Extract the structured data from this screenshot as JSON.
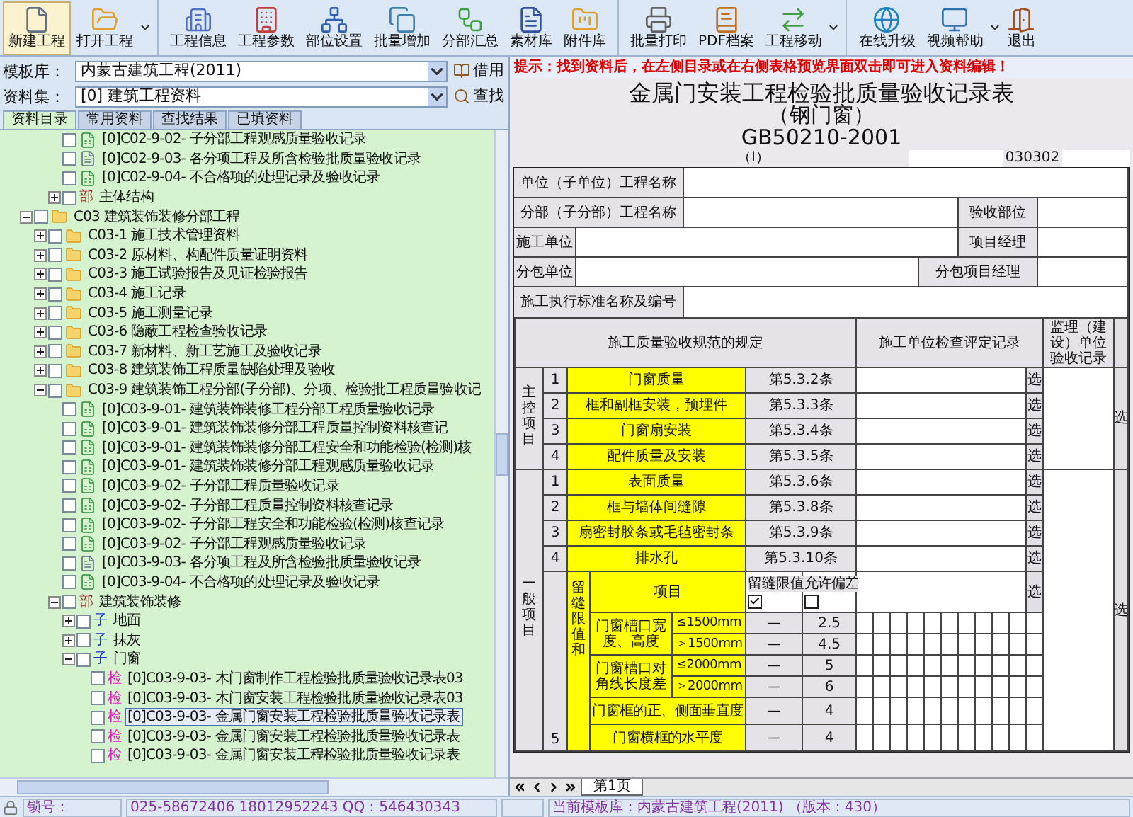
{
  "toolbar": {
    "groups": [
      {
        "items": [
          {
            "label": "新建工程",
            "selected": true,
            "dropdown": false
          },
          {
            "label": "打开工程",
            "selected": false,
            "dropdown": true
          }
        ]
      },
      {
        "items": [
          {
            "label": "工程信息",
            "selected": false,
            "dropdown": false
          },
          {
            "label": "工程参数",
            "selected": false,
            "dropdown": false
          },
          {
            "label": "部位设置",
            "selected": false,
            "dropdown": false
          },
          {
            "label": "批量增加",
            "selected": false,
            "dropdown": false
          },
          {
            "label": "分部汇总",
            "selected": false,
            "dropdown": false
          },
          {
            "label": "素材库",
            "selected": false,
            "dropdown": false
          },
          {
            "label": "附件库",
            "selected": false,
            "dropdown": false
          }
        ]
      },
      {
        "items": [
          {
            "label": "批量打印",
            "selected": false,
            "dropdown": false
          },
          {
            "label": "PDF档案",
            "selected": false,
            "dropdown": false
          },
          {
            "label": "工程移动",
            "selected": false,
            "dropdown": true
          }
        ]
      },
      {
        "items": [
          {
            "label": "在线升级",
            "selected": false,
            "dropdown": false
          },
          {
            "label": "视频帮助",
            "selected": false,
            "dropdown": true
          },
          {
            "label": "退出",
            "selected": false,
            "dropdown": false
          }
        ]
      }
    ]
  },
  "template_library": {
    "label": "模板库：",
    "value": "内蒙古建筑工程(2011)",
    "button": "借用"
  },
  "data_set": {
    "label": "资料集：",
    "value": "[0] 建筑工程资料",
    "button": "查找"
  },
  "tabs": [
    {
      "label": "资料目录",
      "selected": true
    },
    {
      "label": "常用资料",
      "selected": false
    },
    {
      "label": "查找结果",
      "selected": false
    },
    {
      "label": "已填资料",
      "selected": false
    }
  ],
  "tree": [
    {
      "children": [
        {
          "children": [
            {
              "label": "[0]C02-9-02- 子分部工程观感质量验收记录",
              "kind": "sheet",
              "checked": false,
              "selected": false
            },
            {
              "label": "[0]C02-9-03- 各分项工程及所含检验批质量验收记录",
              "kind": "document",
              "checked": false,
              "selected": false
            },
            {
              "label": "[0]C02-9-04- 不合格项的处理记录及验收记录",
              "kind": "sheet",
              "checked": false,
              "selected": false
            },
            {
              "label": "主体结构",
              "kind": "tag",
              "tag": "部",
              "color": "#a52a2a",
              "expanded": false,
              "checked": false,
              "selected": false
            }
          ]
        }
      ]
    },
    {
      "label": "C03 建筑装饰装修分部工程",
      "kind": "folder",
      "expanded": true,
      "checked": false,
      "selected": false,
      "children": [
        {
          "label": "C03-1 施工技术管理资料",
          "kind": "folder",
          "expanded": false,
          "checked": false,
          "selected": false
        },
        {
          "label": "C03-2 原材料、构配件质量证明资料",
          "kind": "folder",
          "expanded": false,
          "checked": false,
          "selected": false
        },
        {
          "label": "C03-3 施工试验报告及见证检验报告",
          "kind": "folder",
          "expanded": false,
          "checked": false,
          "selected": false
        },
        {
          "label": "C03-4 施工记录",
          "kind": "folder",
          "expanded": false,
          "checked": false,
          "selected": false
        },
        {
          "label": "C03-5 施工测量记录",
          "kind": "folder",
          "expanded": false,
          "checked": false,
          "selected": false
        },
        {
          "label": "C03-6 隐蔽工程检查验收记录",
          "kind": "folder",
          "expanded": false,
          "checked": false,
          "selected": false
        },
        {
          "label": "C03-7 新材料、新工艺施工及验收记录",
          "kind": "folder",
          "expanded": false,
          "checked": false,
          "selected": false
        },
        {
          "label": "C03-8 建筑装饰工程质量缺陷处理及验收",
          "kind": "folder",
          "expanded": false,
          "checked": false,
          "selected": false
        },
        {
          "label": "C03-9 建筑装饰工程分部(子分部)、分项、检验批工程质量验收记",
          "kind": "folder",
          "expanded": true,
          "checked": false,
          "selected": false,
          "children": [
            {
              "label": "[0]C03-9-01- 建筑装饰装修工程分部工程质量验收记录",
              "kind": "sheet",
              "checked": false,
              "selected": false
            },
            {
              "label": "[0]C03-9-01- 建筑装饰装修分部工程质量控制资料核查记",
              "kind": "sheet",
              "checked": false,
              "selected": false
            },
            {
              "label": "[0]C03-9-01- 建筑装饰装修分部工程安全和功能检验(检测)核",
              "kind": "sheet",
              "checked": false,
              "selected": false
            },
            {
              "label": "[0]C03-9-01- 建筑装饰装修分部工程观感质量验收记录",
              "kind": "sheet",
              "checked": false,
              "selected": false
            },
            {
              "label": "[0]C03-9-02- 子分部工程质量验收记录",
              "kind": "sheet",
              "checked": false,
              "selected": false
            },
            {
              "label": "[0]C03-9-02- 子分部工程质量控制资料核查记录",
              "kind": "sheet",
              "checked": false,
              "selected": false
            },
            {
              "label": "[0]C03-9-02- 子分部工程安全和功能检验(检测)核查记录",
              "kind": "sheet",
              "checked": false,
              "selected": false
            },
            {
              "label": "[0]C03-9-02- 子分部工程观感质量验收记录",
              "kind": "sheet",
              "checked": false,
              "selected": false
            },
            {
              "label": "[0]C03-9-03- 各分项工程及所含检验批质量验收记录",
              "kind": "document",
              "checked": false,
              "selected": false
            },
            {
              "label": "[0]C03-9-04- 不合格项的处理记录及验收记录",
              "kind": "sheet",
              "checked": false,
              "selected": false
            },
            {
              "label": "建筑装饰装修",
              "kind": "tag",
              "tag": "部",
              "color": "#a52a2a",
              "expanded": true,
              "checked": false,
              "selected": false,
              "children": [
                {
                  "label": "地面",
                  "kind": "tag",
                  "tag": "子",
                  "color": "#1030e0",
                  "expanded": false,
                  "checked": false,
                  "selected": false
                },
                {
                  "label": "抹灰",
                  "kind": "tag",
                  "tag": "子",
                  "color": "#1030e0",
                  "expanded": false,
                  "checked": false,
                  "selected": false
                },
                {
                  "label": "门窗",
                  "kind": "tag",
                  "tag": "子",
                  "color": "#1030e0",
                  "expanded": true,
                  "checked": false,
                  "selected": false,
                  "children": [
                    {
                      "label": "[0]C03-9-03- 木门窗制作工程检验批质量验收记录表03",
                      "kind": "tag",
                      "tag": "检",
                      "color": "#e020c0",
                      "checked": false,
                      "selected": false
                    },
                    {
                      "label": "[0]C03-9-03- 木门窗安装工程检验批质量验收记录表03",
                      "kind": "tag",
                      "tag": "检",
                      "color": "#e020c0",
                      "checked": false,
                      "selected": false
                    },
                    {
                      "label": "[0]C03-9-03- 金属门窗安装工程检验批质量验收记录表",
                      "kind": "tag",
                      "tag": "检",
                      "color": "#e020c0",
                      "checked": false,
                      "selected": true
                    },
                    {
                      "label": "[0]C03-9-03- 金属门窗安装工程检验批质量验收记录表",
                      "kind": "tag",
                      "tag": "检",
                      "color": "#e020c0",
                      "checked": false,
                      "selected": false
                    },
                    {
                      "label": "[0]C03-9-03- 金属门窗安装工程检验批质量验收记录表",
                      "kind": "tag",
                      "tag": "检",
                      "color": "#e020c0",
                      "checked": false,
                      "selected": false
                    }
                  ]
                }
              ]
            }
          ]
        }
      ]
    }
  ],
  "left_status": {
    "lock_label": "锁号：",
    "contact": "025-58672406  18012952243   QQ：546430343"
  },
  "hint": "提示：找到资料后，在左侧目录或在右侧表格预览界面双击即可进入资料编辑！",
  "form": {
    "title": "金属门安装工程检验批质量验收记录表",
    "subtitle": "（钢门窗）",
    "standard": "GB50210-2001",
    "section": "（Ⅰ）",
    "code": "030302",
    "unit_label": "单位（子单位）工程名称",
    "subunit_label": "分部（子分部）工程名称",
    "part_label": "验收部位",
    "contractor_label": "施工单位",
    "manager_label": "项目经理",
    "subcontractor_label": "分包单位",
    "sub_manager_label": "分包项目经理",
    "standard_label": "施工执行标准名称及编号",
    "header": {
      "spec": "施工质量验收规范的规定",
      "check": "施工单位检查评定记录",
      "supervision": "监理（建设）单位验收记录"
    },
    "main_items": {
      "label": "主控项目",
      "button": "选",
      "items": [
        {
          "no": "1",
          "name": "门窗质量",
          "clause": "第5.3.2条",
          "button": "选"
        },
        {
          "no": "2",
          "name": "框和副框安装，预埋件",
          "clause": "第5.3.3条",
          "button": "选"
        },
        {
          "no": "3",
          "name": "门窗扇安装",
          "clause": "第5.3.4条",
          "button": "选"
        },
        {
          "no": "4",
          "name": "配件质量及安装",
          "clause": "第5.3.5条",
          "button": "选"
        }
      ]
    },
    "general_items": {
      "label": "一般项目",
      "button": "选",
      "items": [
        {
          "no": "1",
          "name": "表面质量",
          "clause": "第5.3.6条",
          "button": "选"
        },
        {
          "no": "2",
          "name": "框与墙体间缝隙",
          "clause": "第5.3.8条",
          "button": "选"
        },
        {
          "no": "3",
          "name": "扇密封胶条或毛毡密封条",
          "clause": "第5.3.9条",
          "button": "选"
        },
        {
          "no": "4",
          "name": "排水孔",
          "clause": "第5.3.10条",
          "button": "选"
        }
      ]
    },
    "tolerance": {
      "no": "5",
      "group": "留缝限值和",
      "item_header": "项目",
      "gap_header": "留缝限值",
      "gap_checked": true,
      "dev_header": "允许偏差",
      "dev_checked": false,
      "button": "选",
      "rows": [
        {
          "kind": "split",
          "name": "门窗槽口宽度、高度",
          "sub": [
            {
              "range": "≤1500mm",
              "gap": "—",
              "dev": "2.5"
            },
            {
              "range": "＞1500mm",
              "gap": "—",
              "dev": "4.5"
            }
          ]
        },
        {
          "kind": "split",
          "name": "门窗槽口对角线长度差",
          "sub": [
            {
              "range": "≤2000mm",
              "gap": "—",
              "dev": "5"
            },
            {
              "range": "＞2000mm",
              "gap": "—",
              "dev": "6"
            }
          ]
        },
        {
          "kind": "single",
          "name": "门窗框的正、侧面垂直度",
          "gap": "—",
          "dev": "4"
        },
        {
          "kind": "single",
          "name": "门窗横框的水平度",
          "gap": "—",
          "dev": "4"
        }
      ]
    }
  },
  "sheet_tabs": [
    {
      "label": "第1页",
      "selected": true
    }
  ],
  "status": "当前模板库：内蒙古建筑工程(2011) （版本：430）"
}
